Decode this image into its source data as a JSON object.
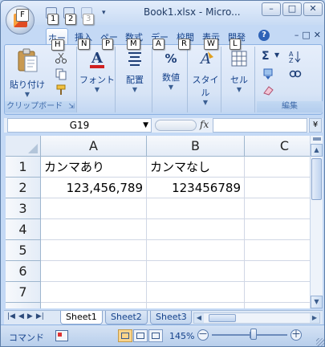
{
  "title_bar": {
    "title": "Book1.xlsx - Micro...",
    "office_button_keytip": "F",
    "qat_keytips": [
      "1",
      "2",
      "3"
    ],
    "qat_dropdown": "▾",
    "window_buttons": [
      "–",
      "□",
      "✕"
    ]
  },
  "ribbon_tabs": [
    {
      "label": "ホー",
      "keytip": "H",
      "active": true
    },
    {
      "label": "挿入",
      "keytip": "N"
    },
    {
      "label": "ペー",
      "keytip": "P"
    },
    {
      "label": "数式",
      "keytip": "M"
    },
    {
      "label": "デー",
      "keytip": "A"
    },
    {
      "label": "校閲",
      "keytip": "R"
    },
    {
      "label": "表示",
      "keytip": "W"
    },
    {
      "label": "開発",
      "keytip": "L"
    }
  ],
  "ribbon_right": {
    "help": "?",
    "min": "–",
    "restore": "□",
    "close": "✕"
  },
  "ribbon_groups": {
    "clipboard": {
      "paste_label": "貼り付け",
      "group_label": "クリップボード",
      "launcher": "⇲"
    },
    "font": {
      "label": "フォント"
    },
    "alignment": {
      "label": "配置"
    },
    "number": {
      "label": "数値",
      "symbol": "%"
    },
    "styles": {
      "label": "スタイル"
    },
    "cells": {
      "label": "セル"
    },
    "editing": {
      "group_label": "編集",
      "sum_symbol": "Σ"
    }
  },
  "formula_bar": {
    "name_box": "G19",
    "fx": "fx",
    "formula": "",
    "expand": "¥"
  },
  "grid": {
    "columns": [
      "A",
      "B",
      "C"
    ],
    "rows": [
      "1",
      "2",
      "3",
      "4",
      "5",
      "6",
      "7"
    ],
    "cells": {
      "A1": "カンマあり",
      "B1": "カンマなし",
      "A2": "123,456,789",
      "B2": "123456789"
    }
  },
  "sheet_tabs": [
    "Sheet1",
    "Sheet2",
    "Sheet3"
  ],
  "active_sheet": "Sheet1",
  "status_bar": {
    "mode": "コマンド",
    "zoom": "145%",
    "zoom_minus": "－",
    "zoom_plus": "＋"
  }
}
